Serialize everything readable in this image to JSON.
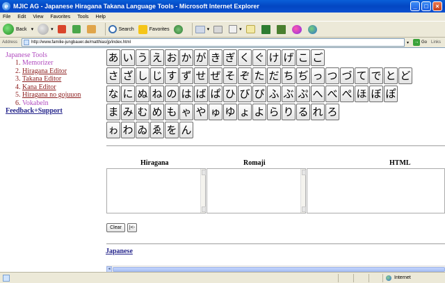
{
  "window": {
    "title": "MJIC AG - Japanese Hiragana Takana Language Tools - Microsoft Internet Explorer",
    "min": "_",
    "max": "□",
    "close": "×"
  },
  "menu": [
    "File",
    "Edit",
    "View",
    "Favorites",
    "Tools",
    "Help"
  ],
  "toolbar": {
    "back": "Back",
    "search": "Search",
    "favorites": "Favorites"
  },
  "address": {
    "label": "Address",
    "url": "http://www.familie-jungbauer.de/matthias/jp/index.html",
    "go": "Go",
    "links": "Links"
  },
  "nav": {
    "title": "Japanese Tools",
    "items": [
      {
        "num": "1.",
        "label": "Memorizer"
      },
      {
        "num": "2.",
        "label": "Hiragana Editor"
      },
      {
        "num": "3.",
        "label": "Takana Editor"
      },
      {
        "num": "4.",
        "label": "Kana Editor"
      },
      {
        "num": "5.",
        "label": "Hiragana no gojuuon"
      },
      {
        "num": "6.",
        "label": "Vokabeln"
      }
    ],
    "feedback": "Feedback+Support"
  },
  "keyboard": {
    "row1": [
      "あ",
      "い",
      "う",
      "え",
      "お",
      "か",
      "が",
      "き",
      "ぎ",
      "く",
      "ぐ",
      "け",
      "げ",
      "こ",
      "ご"
    ],
    "row2": [
      "さ",
      "ざ",
      "し",
      "じ",
      "す",
      "ず",
      "せ",
      "ぜ",
      "そ",
      "ぞ",
      "た",
      "だ",
      "ち",
      "ぢ",
      "っ",
      "つ",
      "づ",
      "て",
      "で",
      "と",
      "ど"
    ],
    "row3": [
      "な",
      "に",
      "ぬ",
      "ね",
      "の",
      "は",
      "ば",
      "ぱ",
      "ひ",
      "び",
      "ぴ",
      "ふ",
      "ぶ",
      "ぷ",
      "へ",
      "べ",
      "ぺ",
      "ほ",
      "ぼ",
      "ぽ"
    ],
    "row4": [
      "ま",
      "み",
      "む",
      "め",
      "も",
      "ゃ",
      "や",
      "ゅ",
      "ゆ",
      "ょ",
      "よ",
      "ら",
      "り",
      "る",
      "れ",
      "ろ"
    ],
    "row5": [
      "ゎ",
      "わ",
      "ゐ",
      "ゑ",
      "を",
      "ん"
    ]
  },
  "editor": {
    "col_hiragana": "Hiragana",
    "col_romaji": "Romaji",
    "col_html": "HTML",
    "clear": "Clear",
    "backspace": "|<-"
  },
  "footer_link": "Japanese",
  "status": {
    "zone": "Internet"
  }
}
